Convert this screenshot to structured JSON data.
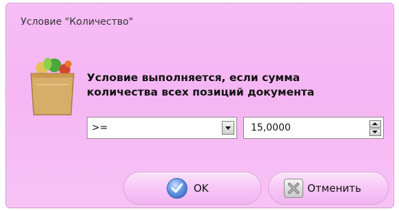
{
  "dialog": {
    "title": "Условие \"Количество\"",
    "icon": "grocery-bag-icon",
    "message_line1": "Условие выполняется, если сумма",
    "message_line2": "количества всех позиций документа",
    "operator": {
      "selected": ">="
    },
    "value": "15,0000",
    "buttons": {
      "ok_label": "OK",
      "cancel_label": "Отменить"
    },
    "colors": {
      "background": "#f5b6f3",
      "border": "#d48ed3",
      "ok_icon": "#3d6fc4"
    }
  }
}
